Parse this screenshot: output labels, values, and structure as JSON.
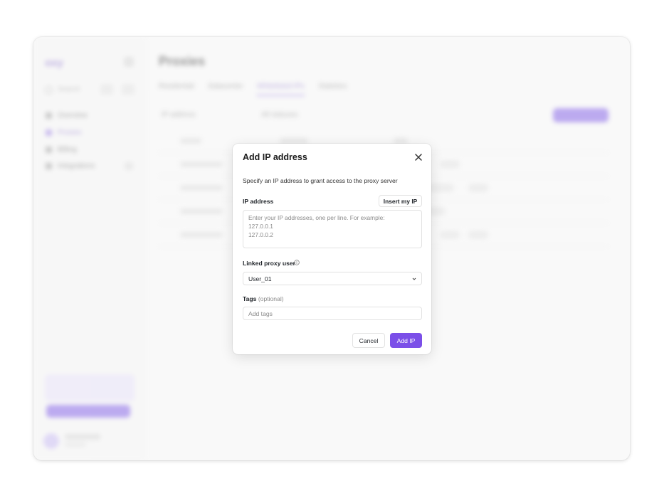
{
  "background_app": {
    "logo": "oxy",
    "search_placeholder": "Search",
    "nav": [
      "Overview",
      "Proxies",
      "Billing",
      "Integrations"
    ],
    "page_title": "Proxies",
    "tabs": [
      "Residential",
      "Datacenter",
      "Whitelisted IPs",
      "Statistics"
    ],
    "filters_label": "IP address",
    "filters_label2": "All statuses"
  },
  "modal": {
    "title": "Add IP address",
    "description": "Specify an IP address to grant access to the proxy server",
    "ip_label": "IP address",
    "insert_button": "Insert my IP",
    "ip_placeholder": "Enter your IP addresses, one per line. For example:\n127.0.0.1\n127.0.0.2",
    "linked_user_label": "Linked proxy user",
    "linked_user_value": "User_01",
    "tags_label": "Tags",
    "tags_optional": "(optional)",
    "tags_placeholder": "Add tags",
    "cancel_button": "Cancel",
    "submit_button": "Add IP"
  },
  "colors": {
    "accent": "#7b4fe8",
    "border": "#e2e2e2"
  }
}
